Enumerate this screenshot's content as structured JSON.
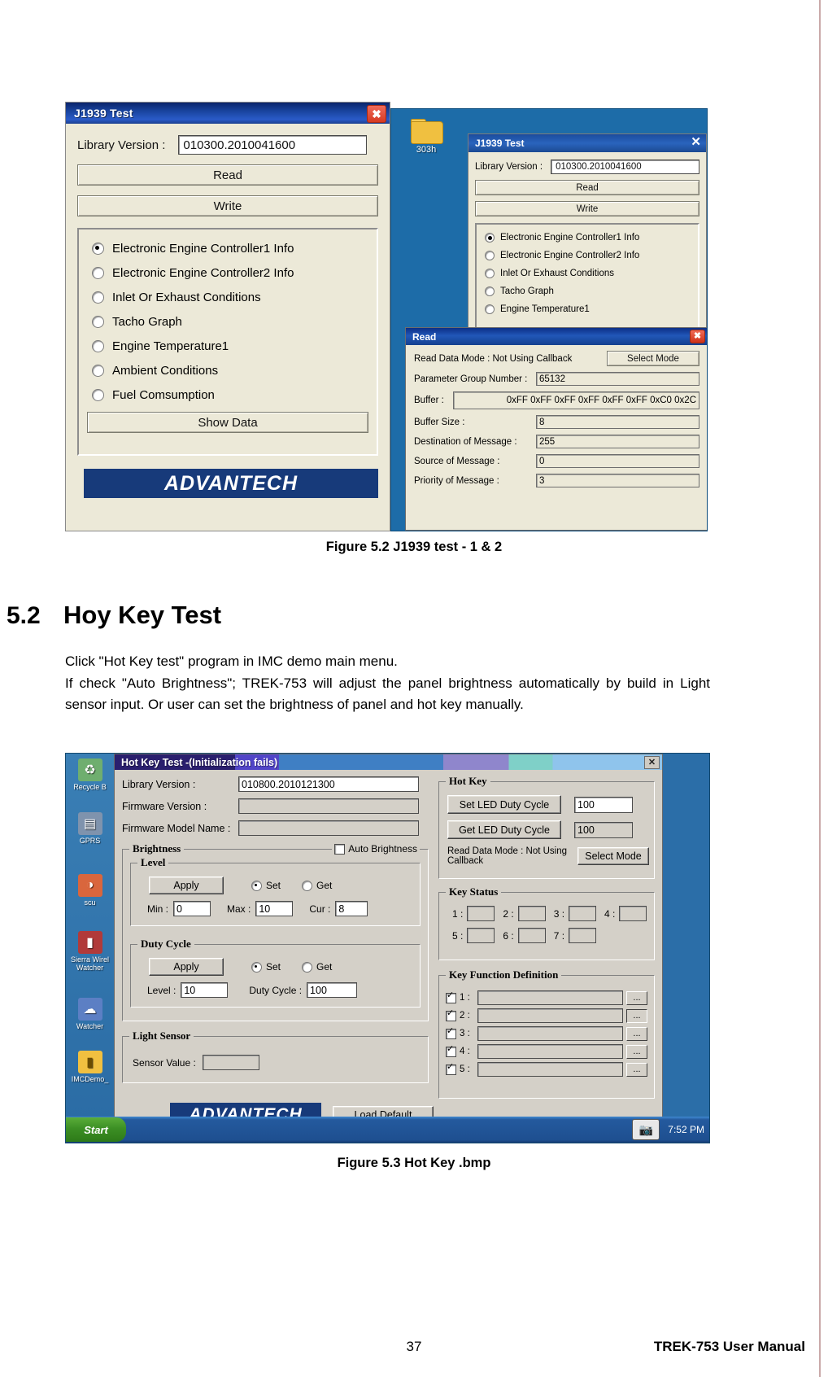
{
  "page": {
    "number": "37",
    "footer_right": "TREK-753 User Manual"
  },
  "figure_52": {
    "caption": "Figure 5.2 J1939 test - 1 & 2",
    "left_dialog": {
      "title": "J1939 Test",
      "close_glyph": "✖",
      "library_version_label": "Library Version :",
      "library_version_value": "010300.2010041600",
      "read_button": "Read",
      "write_button": "Write",
      "options": [
        {
          "label": "Electronic Engine Controller1 Info",
          "selected": true
        },
        {
          "label": "Electronic Engine Controller2 Info",
          "selected": false
        },
        {
          "label": "Inlet Or Exhaust Conditions",
          "selected": false
        },
        {
          "label": "Tacho Graph",
          "selected": false
        },
        {
          "label": "Engine Temperature1",
          "selected": false
        },
        {
          "label": "Ambient Conditions",
          "selected": false
        },
        {
          "label": "Fuel Comsumption",
          "selected": false
        }
      ],
      "show_data_button": "Show Data",
      "logo": "ADVANTECH"
    },
    "desktop": {
      "folder_icon_label": "303h"
    },
    "right_dialog": {
      "title": "J1939 Test",
      "close_glyph": "✕",
      "library_version_label": "Library Version :",
      "library_version_value": "010300.2010041600",
      "read_button": "Read",
      "write_button": "Write",
      "options": [
        {
          "label": "Electronic Engine Controller1 Info",
          "selected": true
        },
        {
          "label": "Electronic Engine Controller2 Info",
          "selected": false
        },
        {
          "label": "Inlet Or Exhaust Conditions",
          "selected": false
        },
        {
          "label": "Tacho Graph",
          "selected": false
        },
        {
          "label": "Engine Temperature1",
          "selected": false
        }
      ]
    },
    "read_dialog": {
      "title": "Read",
      "close_glyph": "✖",
      "mode_label": "Read Data Mode : Not Using Callback",
      "select_mode_button": "Select Mode",
      "fields": [
        {
          "label": "Parameter Group Number :",
          "value": "65132"
        },
        {
          "label": "Buffer :",
          "value": "0xFF 0xFF 0xFF 0xFF 0xFF 0xFF 0xC0 0x2C"
        },
        {
          "label": "Buffer Size :",
          "value": "8"
        },
        {
          "label": "Destination of Message :",
          "value": "255"
        },
        {
          "label": "Source of Message :",
          "value": "0"
        },
        {
          "label": "Priority of Message :",
          "value": "3"
        }
      ]
    }
  },
  "section": {
    "number": "5.2",
    "title": "Hoy Key Test",
    "paragraph1": "Click \"Hot Key test\" program in IMC demo main menu.",
    "paragraph2": "If check \"Auto Brightness\"; TREK-753 will adjust the panel brightness automatically by build in Light sensor input. Or user can set the brightness of panel and hot key manually."
  },
  "figure_53": {
    "caption": "Figure 5.3 Hot Key .bmp",
    "desktop_icons": [
      {
        "label": "Recycle B",
        "glyph": "♻"
      },
      {
        "label": "GPRS",
        "glyph": "὏6"
      },
      {
        "label": "scu",
        "glyph": "◔"
      },
      {
        "label": "Sierra Wirel\nWatcher",
        "glyph": "▰"
      },
      {
        "label": "Watcher",
        "glyph": "☁"
      },
      {
        "label": "IMCDemo_",
        "glyph": "▮"
      }
    ],
    "taskbar": {
      "start_label": "Start",
      "clock": "7:52 PM"
    },
    "window": {
      "title": "Hot Key Test -(Initialization fails)",
      "close_glyph": "✕",
      "library_version_label": "Library Version :",
      "library_version_value": "010800.2010121300",
      "firmware_version_label": "Firmware Version :",
      "firmware_version_value": "",
      "firmware_model_label": "Firmware Model Name :",
      "firmware_model_value": "",
      "brightness": {
        "legend": "Brightness",
        "auto_brightness_label": "Auto Brightness",
        "auto_brightness_checked": false,
        "level": {
          "legend": "Level",
          "apply_button": "Apply",
          "set_label": "Set",
          "get_label": "Get",
          "mode": "Set",
          "min_label": "Min :",
          "min_value": "0",
          "max_label": "Max :",
          "max_value": "10",
          "cur_label": "Cur :",
          "cur_value": "8"
        },
        "duty_cycle": {
          "legend": "Duty Cycle",
          "apply_button": "Apply",
          "set_label": "Set",
          "get_label": "Get",
          "mode": "Set",
          "level_label": "Level :",
          "level_value": "10",
          "duty_label": "Duty Cycle :",
          "duty_value": "100"
        }
      },
      "light_sensor": {
        "legend": "Light Sensor",
        "sensor_value_label": "Sensor Value :",
        "sensor_value": ""
      },
      "hot_key": {
        "legend": "Hot Key",
        "set_led_button": "Set LED Duty Cycle",
        "set_led_value": "100",
        "get_led_button": "Get LED Duty Cycle",
        "get_led_value": "100",
        "read_mode_label": "Read Data Mode : Not Using Callback",
        "select_mode_button": "Select Mode"
      },
      "key_status": {
        "legend": "Key Status",
        "keys": [
          "1 :",
          "2 :",
          "3 :",
          "4 :",
          "5 :",
          "6 :",
          "7 :"
        ]
      },
      "key_function": {
        "legend": "Key Function Definition",
        "rows": [
          {
            "label": "1 :",
            "checked": true,
            "value": "",
            "more": "..."
          },
          {
            "label": "2 :",
            "checked": true,
            "value": "",
            "more": "..."
          },
          {
            "label": "3 :",
            "checked": true,
            "value": "",
            "more": "..."
          },
          {
            "label": "4 :",
            "checked": true,
            "value": "",
            "more": "..."
          },
          {
            "label": "5 :",
            "checked": true,
            "value": "",
            "more": "..."
          }
        ]
      },
      "logo": "ADVANTECH",
      "load_default_button": "Load Default"
    }
  }
}
